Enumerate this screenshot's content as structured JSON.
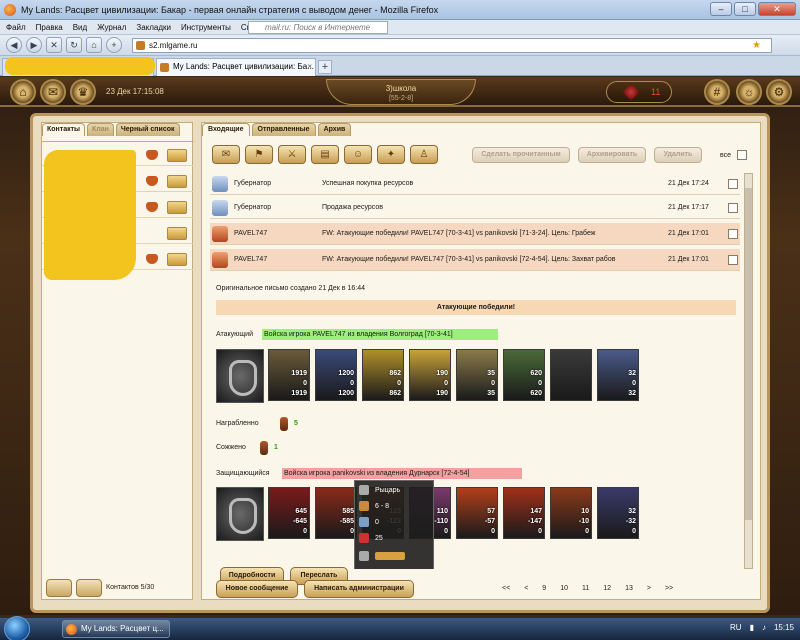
{
  "browser": {
    "window_title": "My Lands: Расцвет цивилизации: Бакар - первая онлайн стратегия с выводом денег - Mozilla Firefox",
    "menu": [
      "Файл",
      "Правка",
      "Вид",
      "Журнал",
      "Закладки",
      "Инструменты",
      "Справка"
    ],
    "search_placeholder": "mail.ru: Поиск в Интернете",
    "url": "s2.mlgame.ru",
    "tab_title": "My Lands: Расцвет цивилизации: Ба...",
    "new_tab": "+",
    "tab_close": "×",
    "win_min": "–",
    "win_max": "□",
    "win_close": "✕"
  },
  "game_header": {
    "datetime": "23 Дек 17:15:08",
    "city": "3)школа",
    "coords": "[55-2-8]",
    "resource_value": "11"
  },
  "left_panel": {
    "tabs": [
      "Контакты",
      "Клан",
      "Черный список"
    ],
    "contacts_count": "Контактов 5/30"
  },
  "right_panel": {
    "tabs": [
      "Входящие",
      "Отправленные",
      "Архив"
    ],
    "action_buttons": [
      "Сделать прочитанным",
      "Архивировать",
      "Удалить"
    ],
    "select_all_label": "все",
    "messages": [
      {
        "from": "Губернатор",
        "subject": "Успешная покупка ресурсов",
        "date": "21 Дек 17:24",
        "kind": "system"
      },
      {
        "from": "Губернатор",
        "subject": "Продажа ресурсов",
        "date": "21 Дек 17:17",
        "kind": "system"
      },
      {
        "from": "PAVEL747",
        "subject": "FW: Атакующие победили! PAVEL747 [70-3-41] vs panikovski [71-3-24]. Цель: Грабеж",
        "date": "21 Дек 17:01",
        "kind": "battle"
      },
      {
        "from": "PAVEL747",
        "subject": "FW: Атакующие победили! PAVEL747 [70-3-41] vs panikovski [72-4-54]. Цель: Захват рабов",
        "date": "21 Дек 17:01",
        "kind": "battle"
      }
    ],
    "report": {
      "original_note": "Оригинальное письмо создано 21 Дек в 16:44",
      "banner": "Атакующие победили!",
      "attacker_label": "Атакующий",
      "attacker_text": "Войска игрока PAVEL747 из владения Волгоград [70-3-41]",
      "attacker_units": [
        {
          "top": "1919",
          "mid": "0",
          "bottom": "1919"
        },
        {
          "top": "1200",
          "mid": "0",
          "bottom": "1200"
        },
        {
          "top": "862",
          "mid": "0",
          "bottom": "862"
        },
        {
          "top": "190",
          "mid": "0",
          "bottom": "190"
        },
        {
          "top": "35",
          "mid": "0",
          "bottom": "35"
        },
        {
          "top": "620",
          "mid": "0",
          "bottom": "620"
        },
        {
          "top": "",
          "mid": "",
          "bottom": ""
        },
        {
          "top": "32",
          "mid": "0",
          "bottom": "32"
        }
      ],
      "looted_label": "Награбленно",
      "looted_value": "5",
      "burned_label": "Сожжено",
      "burned_value": "1",
      "defender_label": "Защищающийся",
      "defender_text": "Войска игрока panikovski из владения Дурнарск [72-4-54]",
      "defender_units": [
        {
          "top": "645",
          "mid": "-645",
          "bottom": "0"
        },
        {
          "top": "585",
          "mid": "-585",
          "bottom": "0"
        },
        {
          "top": "123",
          "mid": "-123",
          "bottom": "0"
        },
        {
          "top": "110",
          "mid": "-110",
          "bottom": "0"
        },
        {
          "top": "57",
          "mid": "-57",
          "bottom": "0"
        },
        {
          "top": "147",
          "mid": "-147",
          "bottom": "0"
        },
        {
          "top": "10",
          "mid": "-10",
          "bottom": "0"
        },
        {
          "top": "32",
          "mid": "-32",
          "bottom": "0"
        }
      ],
      "tooltip": {
        "name": "Рыцарь",
        "attack": "6 - 8",
        "defense": "0",
        "health": "25"
      },
      "details_button": "Подробности",
      "forward_button": "Переслать"
    },
    "footer_buttons": [
      "Новое сообщение",
      "Написать администрации"
    ],
    "pager": [
      "<<",
      "<",
      "9",
      "10",
      "11",
      "12",
      "13",
      ">",
      ">>"
    ]
  },
  "taskbar": {
    "item": "My Lands: Расцвет ц...",
    "lang": "RU",
    "clock": "15:15"
  },
  "colors": {
    "attacker_bar": "#9cef7a",
    "defender_bar": "#f4a0a0",
    "battle_row": "#f6d8c0",
    "banner": "#f6d8b4"
  }
}
